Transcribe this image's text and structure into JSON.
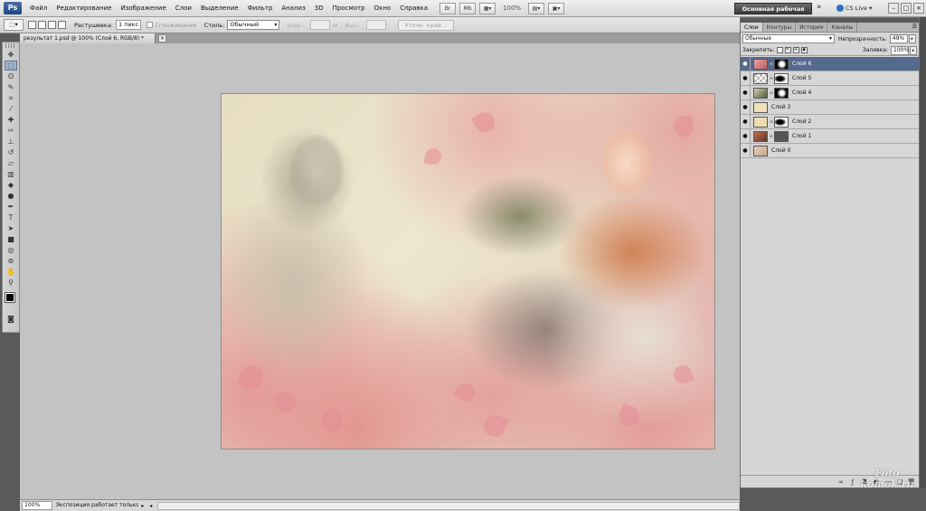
{
  "app": {
    "logo": "Ps"
  },
  "menu": [
    "Файл",
    "Редактирование",
    "Изображение",
    "Слои",
    "Выделение",
    "Фильтр",
    "Анализ",
    "3D",
    "Просмотр",
    "Окно",
    "Справка"
  ],
  "menu_tools": {
    "br": "Br",
    "mb": "Mb",
    "zoom": "100%"
  },
  "workspace": {
    "label": "Основная рабочая среда",
    "chevron": "»",
    "cs_live": "CS Live ▾"
  },
  "window_controls": [
    "–",
    "□",
    "×"
  ],
  "options": {
    "feather_label": "Растушевка:",
    "feather_value": "1 пикс",
    "antialias_label": "Сглаживание",
    "style_label": "Стиль:",
    "style_value": "Обычный",
    "width_label": "Шир.:",
    "height_label": "Выс.:",
    "refine_label": "Уточн. край..."
  },
  "document": {
    "tab_title": "результат 1.psd @ 100% (Слой 6, RGB/8) *",
    "close": "×"
  },
  "status": {
    "zoom": "100%",
    "info": "Экспозиция работает только в ...",
    "arrow_left": "◂",
    "arrow_right": "▸"
  },
  "layers_panel": {
    "tabs": [
      "Слои",
      "Контуры",
      "История",
      "Каналы"
    ],
    "blend_mode": "Обычные",
    "opacity_label": "Непрозрачность:",
    "opacity_value": "49%",
    "lock_label": "Закрепить:",
    "fill_label": "Заливка:",
    "fill_value": "100%",
    "layers": [
      {
        "name": "Слой 6",
        "selected": true
      },
      {
        "name": "Слой 5",
        "selected": false
      },
      {
        "name": "Слой 4",
        "selected": false
      },
      {
        "name": "Слой 3",
        "selected": false
      },
      {
        "name": "Слой 2",
        "selected": false
      },
      {
        "name": "Слой 1",
        "selected": false
      },
      {
        "name": "Слой 0",
        "selected": false
      }
    ]
  },
  "watermark": {
    "line1": "Foto",
    "line2": "komok.ru"
  }
}
